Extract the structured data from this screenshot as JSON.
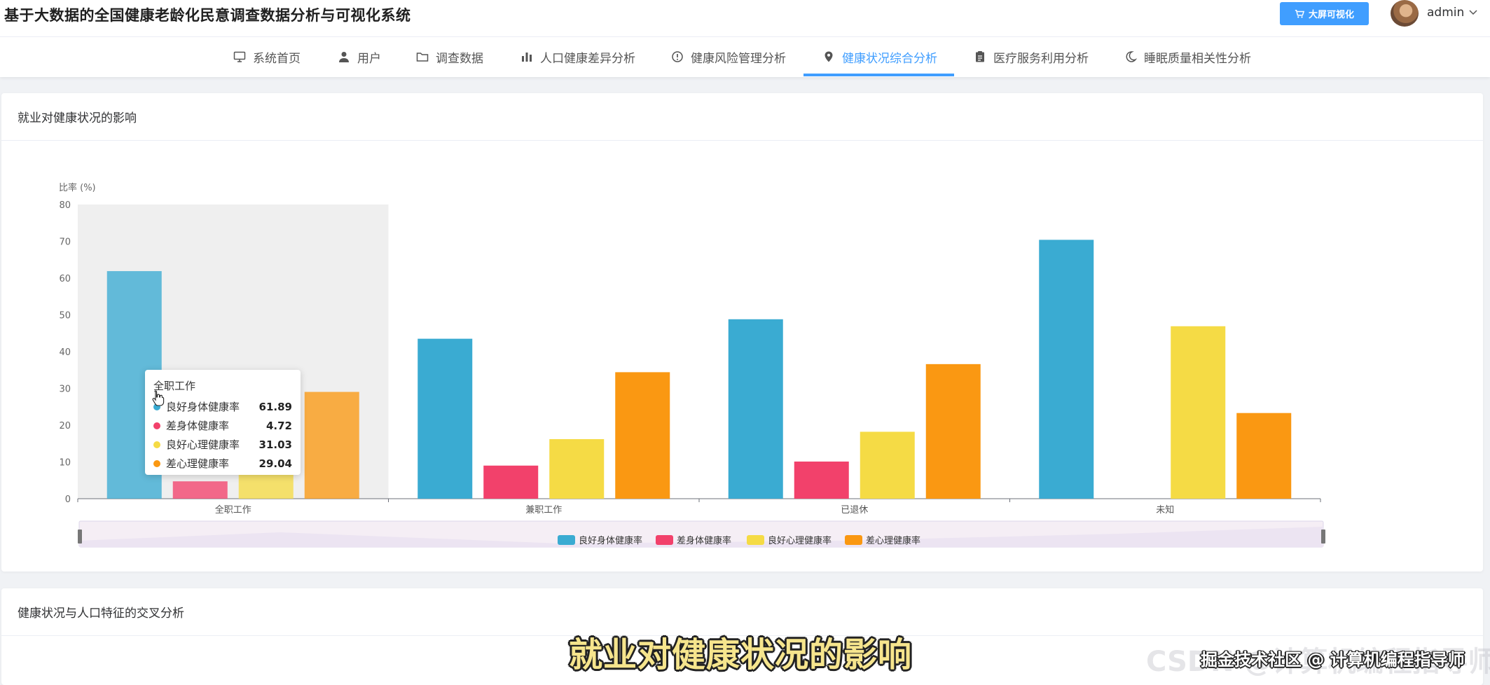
{
  "header": {
    "title": "基于大数据的全国健康老龄化民意调查数据分析与可视化系统",
    "bigscreen_label": "大屏可视化",
    "user": "admin"
  },
  "nav": {
    "items": [
      {
        "label": "系统首页",
        "icon": "monitor-icon"
      },
      {
        "label": "用户",
        "icon": "user-icon"
      },
      {
        "label": "调查数据",
        "icon": "folder-icon"
      },
      {
        "label": "人口健康差异分析",
        "icon": "bar-chart-icon"
      },
      {
        "label": "健康风险管理分析",
        "icon": "info-circle-icon"
      },
      {
        "label": "健康状况综合分析",
        "icon": "location-pin-icon"
      },
      {
        "label": "医疗服务利用分析",
        "icon": "clipboard-icon"
      },
      {
        "label": "睡眠质量相关性分析",
        "icon": "moon-icon"
      }
    ],
    "active_index": 5,
    "active_color": "#409eff"
  },
  "cards": {
    "card1_title": "就业对健康状况的影响",
    "card2_title": "健康状况与人口特征的交叉分析"
  },
  "chart_data": {
    "type": "bar",
    "ylabel": "比率 (%)",
    "ylim": [
      0,
      80
    ],
    "yticks": [
      "0",
      "10",
      "20",
      "30",
      "40",
      "50",
      "60",
      "70",
      "80"
    ],
    "categories": [
      "全职工作",
      "兼职工作",
      "已退休",
      "未知"
    ],
    "series": [
      {
        "name": "良好身体健康率",
        "color": "#3aabd2",
        "values": [
          61.89,
          43.5,
          48.8,
          70.4
        ]
      },
      {
        "name": "差身体健康率",
        "color": "#f2416b",
        "values": [
          4.72,
          9.0,
          10.1,
          0
        ]
      },
      {
        "name": "良好心理健康率",
        "color": "#f5db45",
        "values": [
          31.03,
          16.2,
          18.2,
          46.9
        ]
      },
      {
        "name": "差心理健康率",
        "color": "#fa9812",
        "values": [
          29.04,
          34.4,
          36.6,
          23.3
        ]
      }
    ],
    "highlight_category": 0,
    "legend_position": "bottom",
    "grid": false
  },
  "tooltip": {
    "title": "全职工作",
    "rows": [
      {
        "name": "良好身体健康率",
        "value": "61.89",
        "color": "#3aabd2"
      },
      {
        "name": "差身体健康率",
        "value": "4.72",
        "color": "#f2416b"
      },
      {
        "name": "良好心理健康率",
        "value": "31.03",
        "color": "#f5db45"
      },
      {
        "name": "差心理健康率",
        "value": "29.04",
        "color": "#fa9812"
      }
    ]
  },
  "overlay": {
    "subtitle": "就业对健康状况的影响",
    "watermark": "CSDN @计算机编程指导师",
    "watermark_label": "掘金技术社区 @ 计算机编程指导师"
  }
}
